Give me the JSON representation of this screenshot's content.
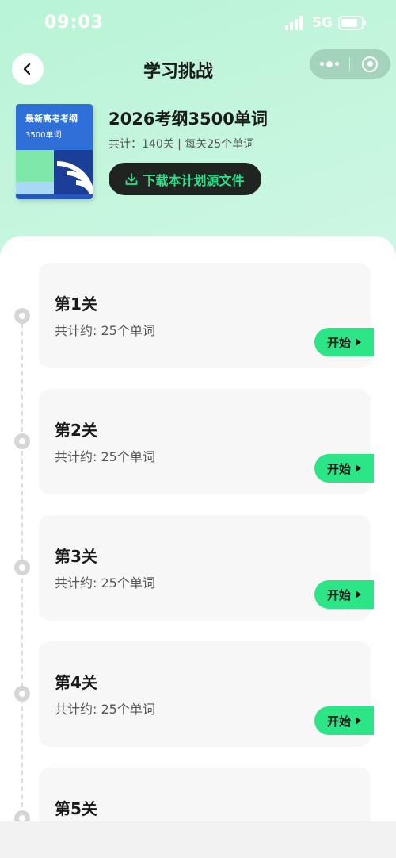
{
  "status_bar": {
    "time": "09:03",
    "network": "5G",
    "icons": [
      "signal-icon",
      "battery-icon"
    ]
  },
  "nav": {
    "title": "学习挑战",
    "back_icon": "chevron-left-icon",
    "capsule_icons": [
      "more-dots-icon",
      "close-circle-icon"
    ]
  },
  "book": {
    "cover_title": "最新高考考纲",
    "cover_subtitle": "3500单词",
    "title": "2026考纲3500单词",
    "stats": "共计：140关 | 每关25个单词",
    "download_label": "下载本计划源文件",
    "download_icon": "download-icon",
    "colors": {
      "cover": "#2f6fd8",
      "accent": "#2be586"
    }
  },
  "levels": [
    {
      "name": "第1关",
      "count": "共计约: 25个单词",
      "button": "开始"
    },
    {
      "name": "第2关",
      "count": "共计约: 25个单词",
      "button": "开始"
    },
    {
      "name": "第3关",
      "count": "共计约: 25个单词",
      "button": "开始"
    },
    {
      "name": "第4关",
      "count": "共计约: 25个单词",
      "button": "开始"
    },
    {
      "name": "第5关",
      "count": "",
      "button": ""
    }
  ]
}
